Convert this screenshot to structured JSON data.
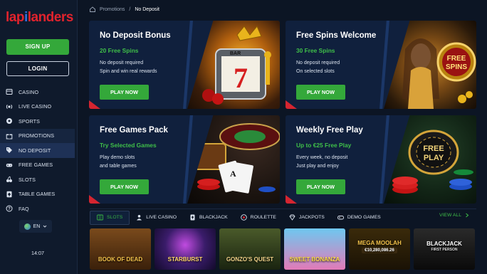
{
  "brand": {
    "logo_part1": "lap",
    "logo_part2": "i",
    "logo_part3": "landers"
  },
  "auth": {
    "signup_label": "SIGN UP",
    "login_label": "LOGIN"
  },
  "nav": {
    "items": [
      {
        "label": "CASINO",
        "icon": "cards-icon"
      },
      {
        "label": "LIVE CASINO",
        "icon": "live-icon"
      },
      {
        "label": "SPORTS",
        "icon": "soccer-ball-icon"
      },
      {
        "label": "PROMOTIONS",
        "icon": "gift-icon"
      },
      {
        "label": "NO DEPOSIT",
        "icon": "tag-icon"
      },
      {
        "label": "FREE GAMES",
        "icon": "gamepad-icon"
      },
      {
        "label": "SLOTS",
        "icon": "cherry-icon"
      },
      {
        "label": "TABLE GAMES",
        "icon": "spade-card-icon"
      },
      {
        "label": "FAQ",
        "icon": "question-icon"
      }
    ],
    "active_index": 4
  },
  "language": {
    "code": "EN"
  },
  "clock": {
    "time": "14:07"
  },
  "breadcrumb": {
    "home_icon": "home-icon",
    "parent": "Promotions",
    "separator": "/",
    "current": "No Deposit"
  },
  "promos": [
    {
      "title": "No Deposit Bonus",
      "subtitle": "20 Free Spins",
      "line1": "No deposit required",
      "line2": "Spin and win real rewards",
      "cta": "PLAY NOW"
    },
    {
      "title": "Free Spins Welcome",
      "subtitle": "30 Free Spins",
      "line1": "No deposit required",
      "line2": "On selected slots",
      "cta": "PLAY NOW"
    },
    {
      "title": "Free Games Pack",
      "subtitle": "Try Selected Games",
      "line1": "Play demo slots",
      "line2": "and table games",
      "cta": "PLAY NOW"
    },
    {
      "title": "Weekly Free Play",
      "subtitle": "Up to €25 Free Play",
      "line1": "Every week, no deposit",
      "line2": "Just play and enjoy",
      "cta": "PLAY NOW"
    }
  ],
  "art_text": {
    "free_spins_badge_line1": "FREE",
    "free_spins_badge_line2": "SPINS",
    "free_play_chip_line1": "FREE",
    "free_play_chip_line2": "PLAY",
    "slot_symbol": "7",
    "slot_bar": "BAR"
  },
  "categories": {
    "tabs": [
      {
        "label": "SLOTS",
        "icon": "slots-icon"
      },
      {
        "label": "LIVE CASINO",
        "icon": "live-person-icon"
      },
      {
        "label": "BLACKJACK",
        "icon": "blackjack-icon"
      },
      {
        "label": "ROULETTE",
        "icon": "roulette-icon"
      },
      {
        "label": "JACKPOTS",
        "icon": "diamond-icon"
      },
      {
        "label": "DEMO GAMES",
        "icon": "gamepad-icon"
      }
    ],
    "active_index": 0,
    "view_all": "VIEW ALL"
  },
  "games": [
    {
      "name": "BOOK OF DEAD",
      "bg": "#5a3312"
    },
    {
      "name": "STARBURST",
      "bg": "#2a1850"
    },
    {
      "name": "GONZO'S QUEST",
      "bg": "#2b3a1c"
    },
    {
      "name": "SWEET BONANZA",
      "bg": "#b34a8a"
    },
    {
      "name": "MEGA MOOLAH",
      "bg": "#6a4a10",
      "sub": "€10,280,086.26"
    },
    {
      "name": "BLACKJACK",
      "sub": "FIRST PERSON",
      "bg": "#1a1a1a"
    }
  ],
  "colors": {
    "accent_green": "#34a83a",
    "brand_red": "#e2232d",
    "brand_blue": "#2f6fe0",
    "card_bg": "#10203d",
    "active_nav": "#1e3156"
  }
}
